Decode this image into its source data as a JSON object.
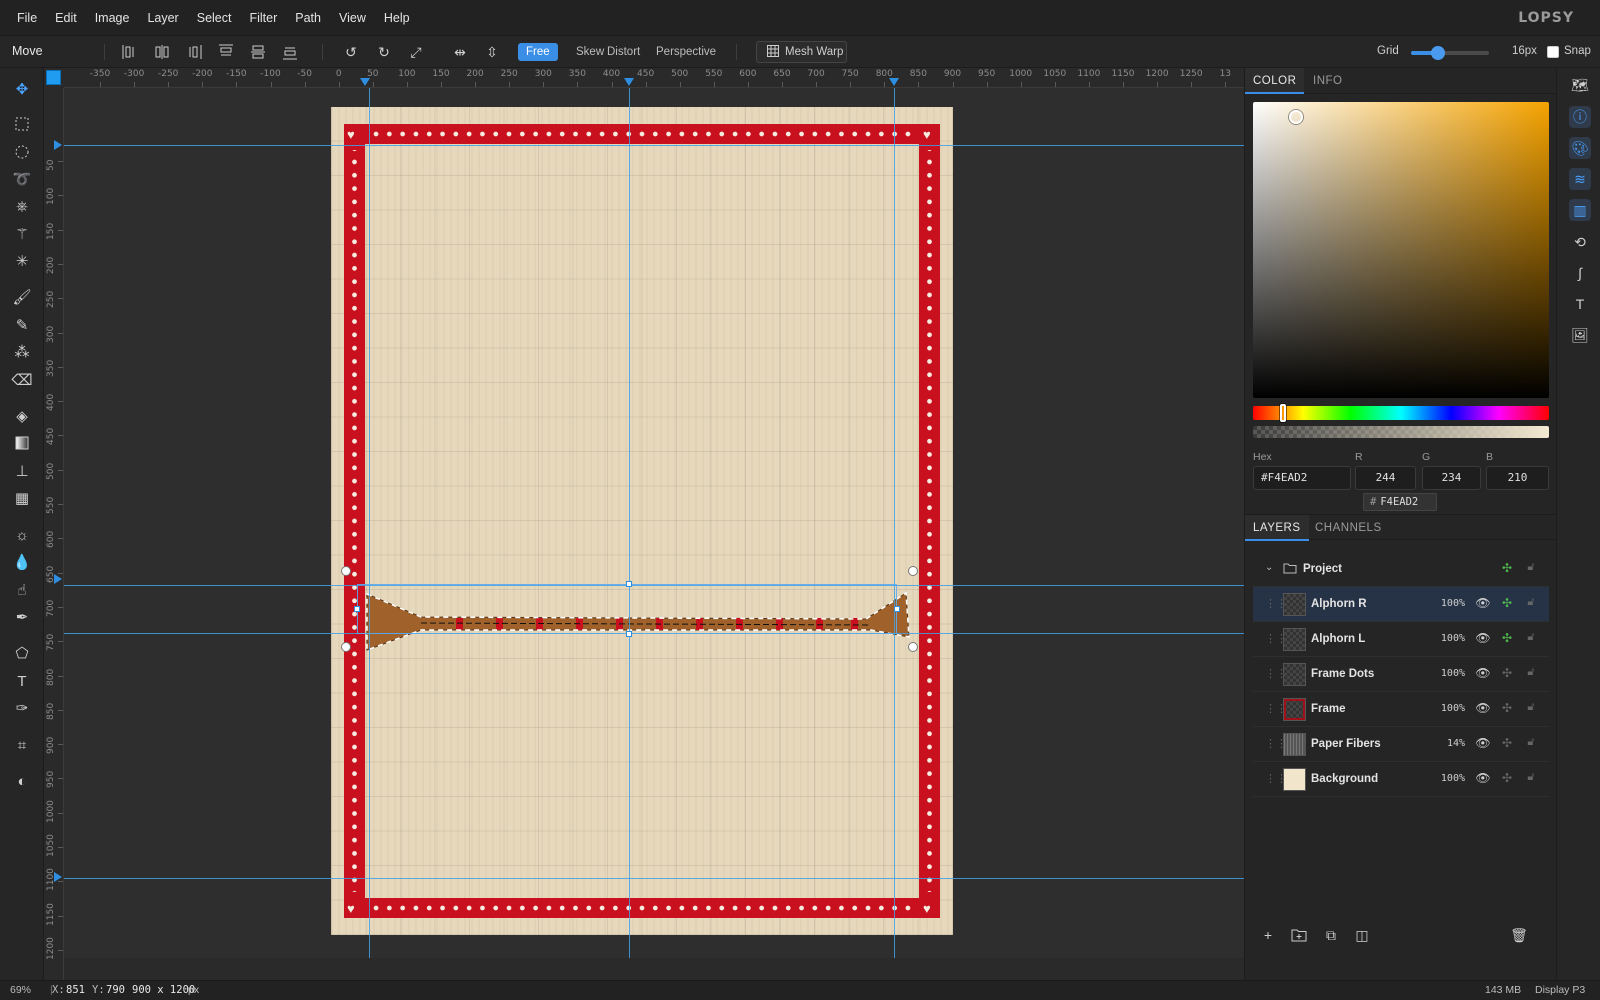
{
  "app": {
    "logo": "LOPSY"
  },
  "menu": [
    "File",
    "Edit",
    "Image",
    "Layer",
    "Select",
    "Filter",
    "Path",
    "View",
    "Help"
  ],
  "options": {
    "tool_name": "Move",
    "transform_modes": [
      "Free",
      "Skew",
      "Distort",
      "Perspective"
    ],
    "active_mode": "Free",
    "mesh_warp": "Mesh Warp",
    "grid_label": "Grid",
    "grid_value": 0.35,
    "grid_size": "16px",
    "snap_label": "Snap",
    "snap_checked": false
  },
  "rulers": {
    "top": [
      "-350",
      "-300",
      "-250",
      "-200",
      "-150",
      "-100",
      "-50",
      "0",
      "50",
      "100",
      "150",
      "200",
      "250",
      "300",
      "350",
      "400",
      "450",
      "500",
      "550",
      "600",
      "650",
      "700",
      "750",
      "800",
      "850",
      "900",
      "950",
      "1000",
      "1050",
      "1100",
      "1150",
      "1200",
      "1250",
      "13"
    ],
    "left": [
      "50",
      "100",
      "150",
      "200",
      "250",
      "300",
      "350",
      "400",
      "450",
      "500",
      "550",
      "600",
      "650",
      "700",
      "750",
      "800",
      "850",
      "900",
      "950",
      "1000",
      "1050",
      "1100",
      "1150",
      "1200"
    ]
  },
  "canvas": {
    "background": "#e6d8bc",
    "frame_color": "#c8101e",
    "dot_color": "#f7ece0"
  },
  "status": {
    "zoom": "69%",
    "x_label": "X:",
    "x_value": "851",
    "y_label": "Y:",
    "y_value": "790",
    "doc_size": "900 x 1200",
    "doc_unit": "px",
    "memory": "143 MB",
    "color_profile": "Display P3"
  },
  "color_panel": {
    "tabs": [
      "COLOR",
      "INFO"
    ],
    "hex_label": "Hex",
    "hex_value": "#F4EAD2",
    "r_label": "R",
    "r_value": "244",
    "g_label": "G",
    "g_value": "234",
    "b_label": "B",
    "b_value": "210",
    "chip_hash": "#",
    "chip_value": "F4EAD2",
    "hue_color": "#f5a300"
  },
  "layers_panel": {
    "tabs": [
      "LAYERS",
      "CHANNELS"
    ],
    "group_name": "Project",
    "layers": [
      {
        "name": "Alphorn R",
        "opacity": "100%",
        "fx": true
      },
      {
        "name": "Alphorn L",
        "opacity": "100%",
        "fx": true
      },
      {
        "name": "Frame Dots",
        "opacity": "100%",
        "fx": false
      },
      {
        "name": "Frame",
        "opacity": "100%",
        "fx": false
      },
      {
        "name": "Paper Fibers",
        "opacity": "14%",
        "fx": false
      },
      {
        "name": "Background",
        "opacity": "100%",
        "fx": false
      }
    ],
    "selected_layer": "Alphorn R"
  }
}
